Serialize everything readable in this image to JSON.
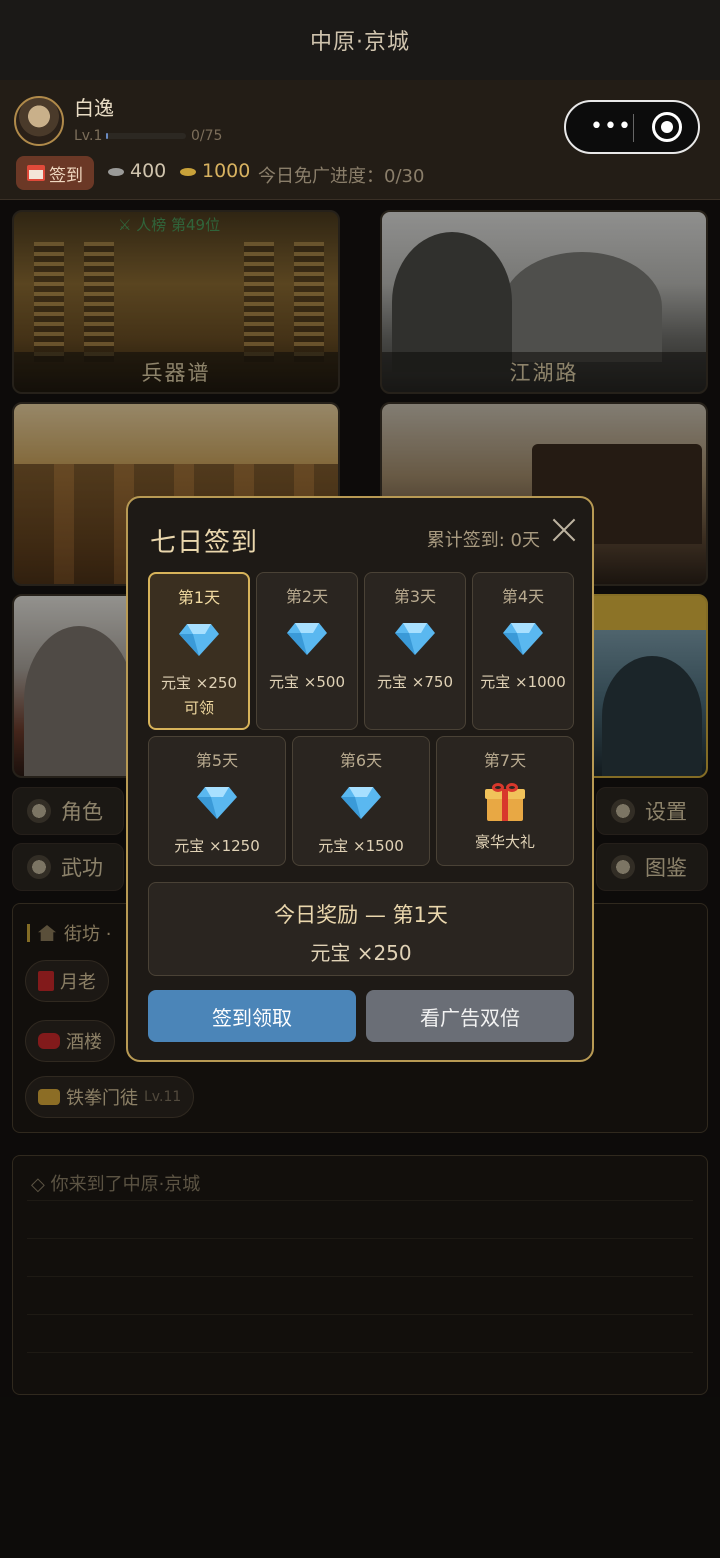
{
  "window": {
    "title": "中原·京城"
  },
  "player": {
    "name": "白逸",
    "level": "Lv.1",
    "xp_text": "0/75",
    "xp_fraction": 0.0
  },
  "hud": {
    "signin_label": "签到",
    "silver": "400",
    "gold": "1000",
    "free_ad_progress": "今日免广进度：0/30"
  },
  "cards": [
    {
      "label": "兵器谱",
      "badge": "人榜 第49位"
    },
    {
      "label": "江湖路"
    },
    {
      "label": ""
    },
    {
      "label": ""
    },
    {
      "label": ""
    },
    {
      "label": ""
    }
  ],
  "menu": {
    "role": "角色",
    "martial": "武功",
    "settings": "设置",
    "codex": "图鉴"
  },
  "street": {
    "title": "街坊 ·",
    "npcs": [
      {
        "name": "月老"
      },
      {
        "name": "酒楼"
      },
      {
        "name": "铁拳门徒",
        "level": "Lv.11"
      }
    ]
  },
  "log": {
    "lines": [
      "◇ 你来到了中原·京城"
    ]
  },
  "modal": {
    "title": "七日签到",
    "total": "累计签到: 0天",
    "days": [
      {
        "label": "第1天",
        "reward": "元宝 ×250",
        "status": "可领",
        "icon": "diamond-icon"
      },
      {
        "label": "第2天",
        "reward": "元宝 ×500",
        "icon": "diamond-icon"
      },
      {
        "label": "第3天",
        "reward": "元宝 ×750",
        "icon": "diamond-icon"
      },
      {
        "label": "第4天",
        "reward": "元宝 ×1000",
        "icon": "diamond-icon"
      },
      {
        "label": "第5天",
        "reward": "元宝 ×1250",
        "icon": "diamond-icon"
      },
      {
        "label": "第6天",
        "reward": "元宝 ×1500",
        "icon": "diamond-icon"
      },
      {
        "label": "第7天",
        "reward": "豪华大礼",
        "icon": "gift-icon"
      }
    ],
    "today_title": "今日奖励 — 第1天",
    "today_reward": "元宝 ×250",
    "sign_button": "签到领取",
    "ad_button": "看广告双倍"
  },
  "colors": {
    "accent_gold": "#d7b35a",
    "sign_button": "#4b85b8",
    "ad_button": "#6a6e76",
    "rank_green": "#4a9a5a"
  }
}
